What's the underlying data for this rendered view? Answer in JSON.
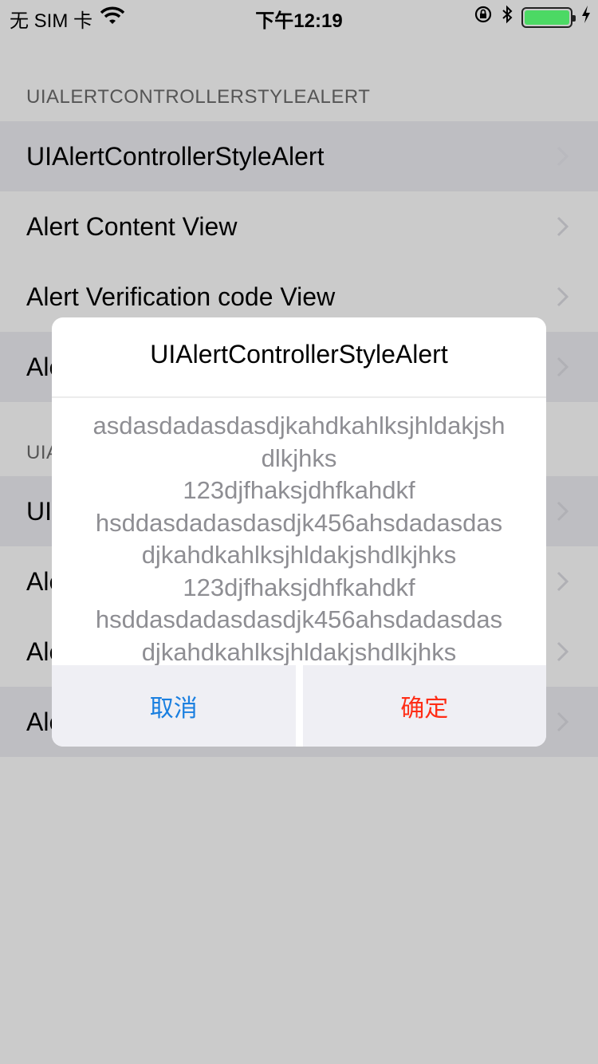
{
  "status_bar": {
    "carrier": "无 SIM 卡",
    "time": "下午12:19",
    "battery_level": 1.0,
    "icons": [
      "wifi-icon",
      "orientation-lock-icon",
      "bluetooth-icon",
      "battery-icon",
      "charging-icon"
    ]
  },
  "sections": [
    {
      "header": "UIALERTCONTROLLERSTYLEALERT",
      "rows": [
        {
          "label": "UIAlertControllerStyleAlert"
        },
        {
          "label": "Alert Content View"
        },
        {
          "label": "Alert Verification code View"
        },
        {
          "label": "Ale"
        }
      ]
    },
    {
      "header": "UIA",
      "rows": [
        {
          "label": "UI"
        },
        {
          "label": "Ale"
        },
        {
          "label": "Ale"
        },
        {
          "label": "Ale"
        }
      ]
    }
  ],
  "alert": {
    "title": "UIAlertControllerStyleAlert",
    "message_lines": [
      "asdasdadasdasdjkahdkahlksjhldakjsh",
      "dlkjhks",
      "123djfhaksjdhfkahdkf",
      "hsddasdadasdasdjk456ahsdadasdas",
      "djkahdkahlksjhldakjshdlkjhks",
      "123djfhaksjdhfkahdkf",
      "hsddasdadasdasdjk456ahsdadasdas",
      "djkahdkahlksjhldakjshdlkjhks"
    ],
    "cancel_label": "取消",
    "confirm_label": "确定",
    "colors": {
      "cancel": "#1a7fe0",
      "confirm": "#ff2d16"
    }
  }
}
